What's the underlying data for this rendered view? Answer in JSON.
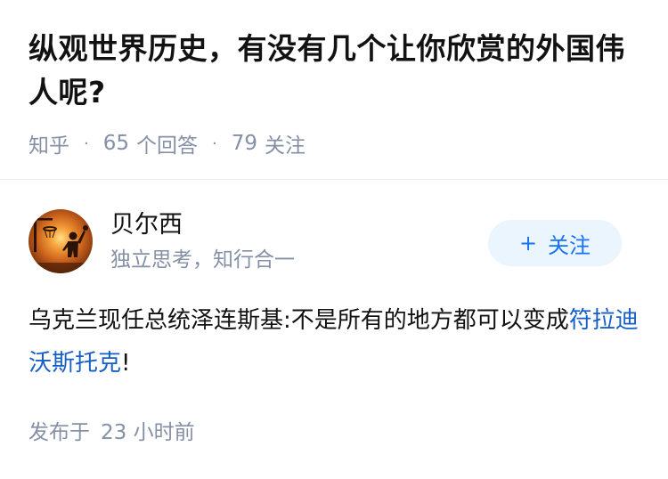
{
  "question": {
    "title": "纵观世界历史，有没有几个让你欣赏的外国伟人呢?",
    "source": "知乎",
    "answer_count": "65",
    "answer_count_label": "个回答",
    "follow_count": "79",
    "follow_count_label": "关注"
  },
  "author": {
    "name": "贝尔西",
    "bio": "独立思考，知行合一",
    "follow_label": "关注",
    "follow_icon": "plus-icon"
  },
  "answer": {
    "text_prefix": "乌克兰现任总统泽连斯基:不是所有的地方都可以变成",
    "link_text": "符拉迪沃斯托克",
    "text_suffix": "!",
    "published_label": "发布于",
    "published_time": "23 小时前"
  },
  "colors": {
    "accent": "#1772f6",
    "link": "#175fc7",
    "meta_text": "#8590a6",
    "follow_button_bg": "#ebf5fd"
  }
}
